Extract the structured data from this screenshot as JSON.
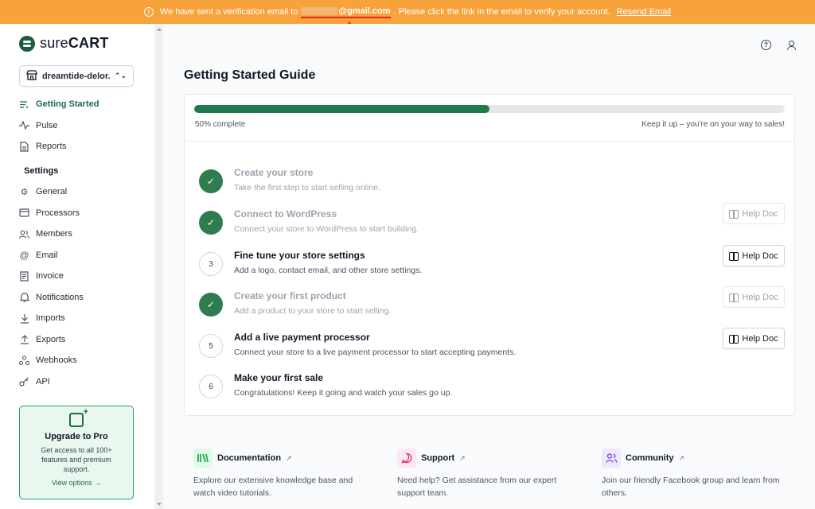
{
  "banner": {
    "prefix": "We have sent a verification email to",
    "email_domain": "@gmail.com",
    "suffix": ". Please click the link in the email to verify your account.",
    "resend_label": "Resend Email",
    "background": "#f7a23b",
    "annotation_color": "#e0241b"
  },
  "brand": {
    "logo_light": "sure",
    "logo_bold": "CART",
    "accent": "#1b6e45"
  },
  "store": {
    "name": "dreamtide-delor..."
  },
  "sidebar": {
    "nav": [
      {
        "label": "Getting Started",
        "icon": "list-icon"
      },
      {
        "label": "Pulse",
        "icon": "activity-icon"
      },
      {
        "label": "Reports",
        "icon": "document-icon"
      }
    ],
    "settings_title": "Settings",
    "settings": [
      {
        "label": "General",
        "icon": "gear-icon"
      },
      {
        "label": "Processors",
        "icon": "credit-card-icon"
      },
      {
        "label": "Members",
        "icon": "users-icon"
      },
      {
        "label": "Email",
        "icon": "at-icon"
      },
      {
        "label": "Invoice",
        "icon": "invoice-icon"
      },
      {
        "label": "Notifications",
        "icon": "bell-icon"
      },
      {
        "label": "Imports",
        "icon": "download-icon"
      },
      {
        "label": "Exports",
        "icon": "upload-icon"
      },
      {
        "label": "Webhooks",
        "icon": "webhook-icon"
      },
      {
        "label": "API",
        "icon": "key-icon"
      }
    ],
    "upgrade": {
      "title": "Upgrade to Pro",
      "text": "Get access to all 100+ features and premium support.",
      "link": "View options"
    }
  },
  "main": {
    "title": "Getting Started Guide",
    "progress": {
      "percent": 50,
      "left": "50% complete",
      "right": "Keep it up – you're on your way to sales!"
    },
    "steps": [
      {
        "badge": "✓",
        "title": "Create your store",
        "desc": "Take the first step to start selling online.",
        "done": true,
        "help": false
      },
      {
        "badge": "✓",
        "title": "Connect to WordPress",
        "desc": "Connect your store to WordPress to start building.",
        "done": true,
        "help": true
      },
      {
        "badge": "3",
        "title": "Fine tune your store settings",
        "desc": "Add a logo, contact email, and other store settings.",
        "done": false,
        "help": true
      },
      {
        "badge": "✓",
        "title": "Create your first product",
        "desc": "Add a product to your store to start selling.",
        "done": true,
        "help": true
      },
      {
        "badge": "5",
        "title": "Add a live payment processor",
        "desc": "Connect your store to a live payment processor to start accepting payments.",
        "done": false,
        "help": true
      },
      {
        "badge": "6",
        "title": "Make your first sale",
        "desc": "Congratulations! Keep it going and watch your sales go up.",
        "done": false,
        "help": false
      }
    ],
    "help_label": "Help Doc",
    "resources": [
      {
        "title": "Documentation",
        "desc": "Explore our extensive knowledge base and watch video tutorials.",
        "icon": "books-icon",
        "color": "#16a34a",
        "bg": "#dcfce7"
      },
      {
        "title": "Support",
        "desc": "Need help? Get assistance from our expert support team.",
        "icon": "chat-icon",
        "color": "#db2777",
        "bg": "#fce7f3"
      },
      {
        "title": "Community",
        "desc": "Join our friendly Facebook group and learn from others.",
        "icon": "users-icon",
        "color": "#7c3aed",
        "bg": "#ede9fe"
      }
    ]
  }
}
